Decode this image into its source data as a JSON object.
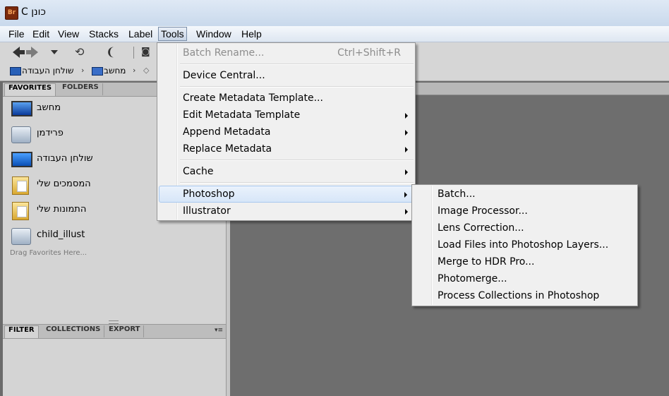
{
  "window": {
    "title": "כונן C",
    "app_badge": "Br"
  },
  "menubar": {
    "items": [
      "File",
      "Edit",
      "View",
      "Stacks",
      "Label",
      "Tools",
      "Window",
      "Help"
    ],
    "active": "Tools"
  },
  "pathbar": {
    "crumbs": [
      "שולחן העבודה",
      "מחשב"
    ]
  },
  "favorites_panel": {
    "tabs": [
      "FAVORITES",
      "FOLDERS"
    ],
    "items": [
      "מחשב",
      "פרידמן",
      "שולחן העבודה",
      "המסמכים שלי",
      "התמונות שלי",
      "child_illust"
    ],
    "drag_hint": "Drag Favorites Here..."
  },
  "filter_panel": {
    "tabs": [
      "FILTER",
      "COLLECTIONS",
      "EXPORT"
    ]
  },
  "tools_menu": {
    "batch_rename": "Batch Rename...",
    "batch_rename_shortcut": "Ctrl+Shift+R",
    "device_central": "Device Central...",
    "create_metadata_template": "Create Metadata Template...",
    "edit_metadata_template": "Edit Metadata Template",
    "append_metadata": "Append Metadata",
    "replace_metadata": "Replace Metadata",
    "cache": "Cache",
    "photoshop": "Photoshop",
    "illustrator": "Illustrator"
  },
  "photoshop_submenu": {
    "items": [
      "Batch...",
      "Image Processor...",
      "Lens Correction...",
      "Load Files into Photoshop Layers...",
      "Merge to HDR Pro...",
      "Photomerge...",
      "Process Collections in Photoshop"
    ]
  }
}
